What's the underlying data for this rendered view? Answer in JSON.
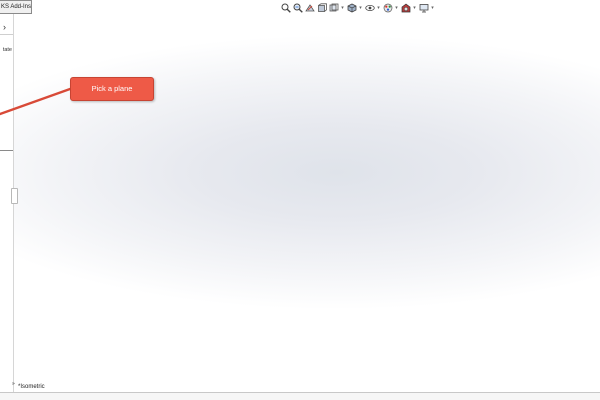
{
  "left_pane": {
    "addins_tab": "KS Add-Ins",
    "expand_glyph": "›",
    "state_label": "tate"
  },
  "hud_toolbar": {
    "icons": [
      "zoom-to-fit-icon",
      "zoom-area-icon",
      "previous-view-icon",
      "section-view-icon",
      "view-orientation-icon",
      "display-style-icon",
      "hide-show-icon",
      "edit-appearance-icon",
      "apply-scene-icon",
      "view-settings-icon"
    ],
    "caret": "▾"
  },
  "callout": {
    "text": "Pick a plane",
    "fill": "#ee5a47"
  },
  "viewport": {
    "view_name": "*Isometric",
    "triad_glyph": "»"
  }
}
